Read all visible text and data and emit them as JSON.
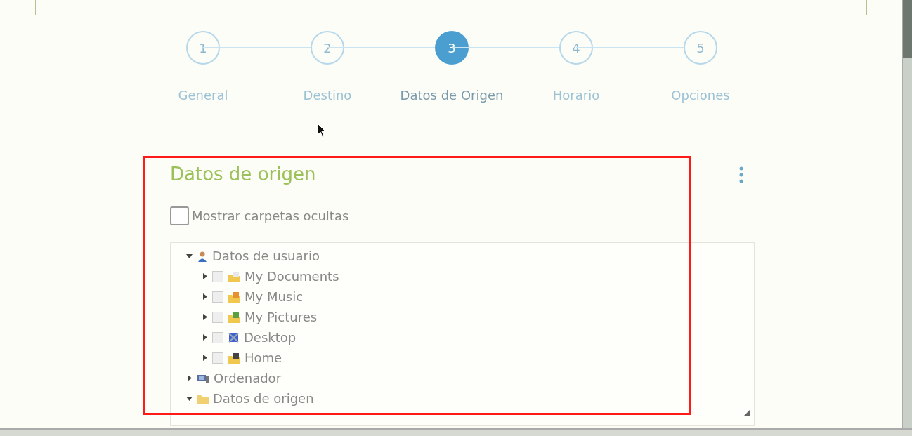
{
  "steps": [
    {
      "number": "1",
      "label": "General",
      "selected": false
    },
    {
      "number": "2",
      "label": "Destino",
      "selected": false
    },
    {
      "number": "3",
      "label": "Datos de Origen",
      "selected": true
    },
    {
      "number": "4",
      "label": "Horario",
      "selected": false
    },
    {
      "number": "5",
      "label": "Opciones",
      "selected": false
    }
  ],
  "section": {
    "title": "Datos de origen",
    "show_hidden": {
      "label": "Mostrar carpetas ocultas",
      "checked": false
    },
    "tree": [
      {
        "label": "Datos de usuario",
        "expanded": true,
        "children": [
          {
            "label": "My Documents",
            "expanded": false,
            "checked": false
          },
          {
            "label": "My Music",
            "expanded": false,
            "checked": false
          },
          {
            "label": "My Pictures",
            "expanded": false,
            "checked": false
          },
          {
            "label": "Desktop",
            "expanded": false,
            "checked": false
          },
          {
            "label": "Home",
            "expanded": false,
            "checked": false
          }
        ]
      },
      {
        "label": "Ordenador",
        "expanded": false
      },
      {
        "label": "Datos de origen",
        "expanded": true
      }
    ]
  }
}
